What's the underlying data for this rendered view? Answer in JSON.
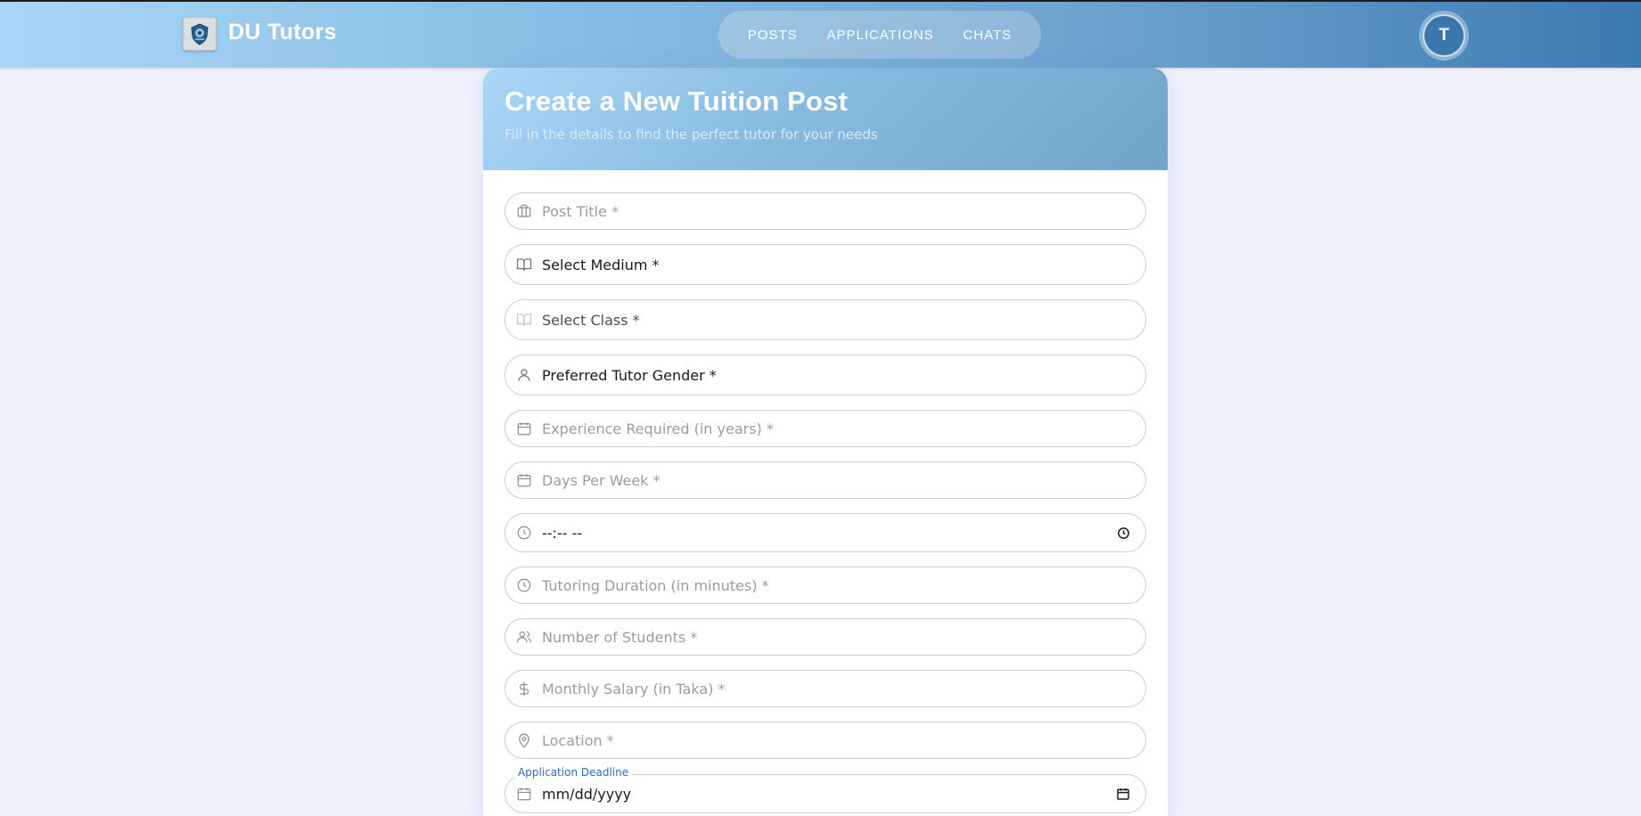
{
  "header": {
    "brand": "DU Tutors",
    "nav": [
      "POSTS",
      "APPLICATIONS",
      "CHATS"
    ],
    "avatar_initial": "T"
  },
  "card": {
    "title": "Create a New Tuition Post",
    "subtitle": "Fill in the details to find the perfect tutor for your needs"
  },
  "form": {
    "post_title": "Post Title *",
    "medium": "Select Medium *",
    "class": "Select Class *",
    "gender": "Preferred Tutor Gender *",
    "experience": "Experience Required (in years) *",
    "days": "Days Per Week *",
    "time": "--:-- --",
    "duration": "Tutoring Duration (in minutes) *",
    "students": "Number of Students *",
    "salary": "Monthly Salary (in Taka) *",
    "location": "Location *",
    "deadline_label": "Application Deadline",
    "deadline": "mm/dd/yyyy"
  }
}
